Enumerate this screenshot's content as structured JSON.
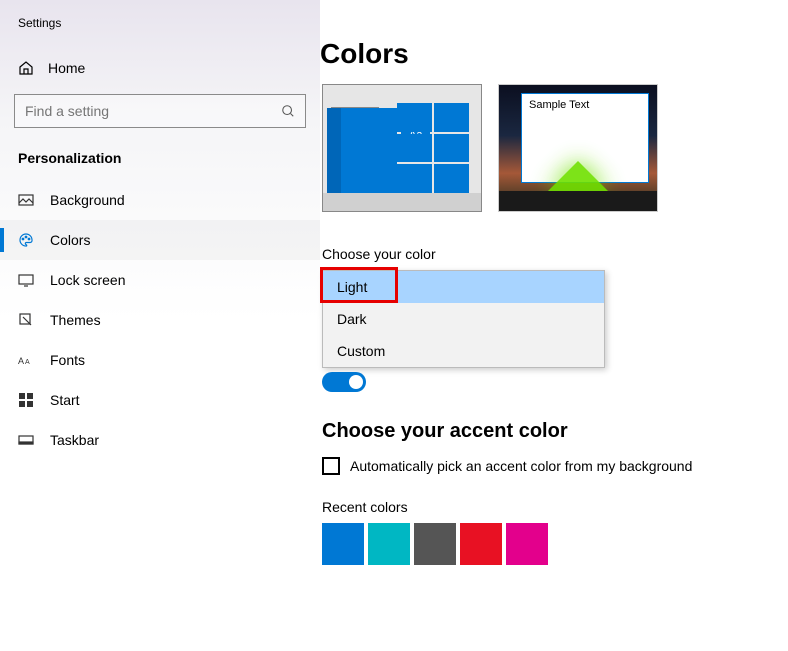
{
  "app_title": "Settings",
  "home_label": "Home",
  "search": {
    "placeholder": "Find a setting"
  },
  "section_label": "Personalization",
  "sidebar": {
    "items": [
      {
        "label": "Background"
      },
      {
        "label": "Colors"
      },
      {
        "label": "Lock screen"
      },
      {
        "label": "Themes"
      },
      {
        "label": "Fonts"
      },
      {
        "label": "Start"
      },
      {
        "label": "Taskbar"
      }
    ]
  },
  "page_title": "Colors",
  "preview": {
    "aa": "Aa",
    "sample_text": "Sample Text"
  },
  "choose_color": {
    "label": "Choose your color",
    "options": [
      "Light",
      "Dark",
      "Custom"
    ],
    "selected": "Light"
  },
  "accent": {
    "title": "Choose your accent color",
    "auto_label": "Automatically pick an accent color from my background"
  },
  "recent_colors": {
    "label": "Recent colors",
    "colors": [
      "#0078d4",
      "#00b7c3",
      "#555555",
      "#e81123",
      "#e3008c"
    ]
  }
}
